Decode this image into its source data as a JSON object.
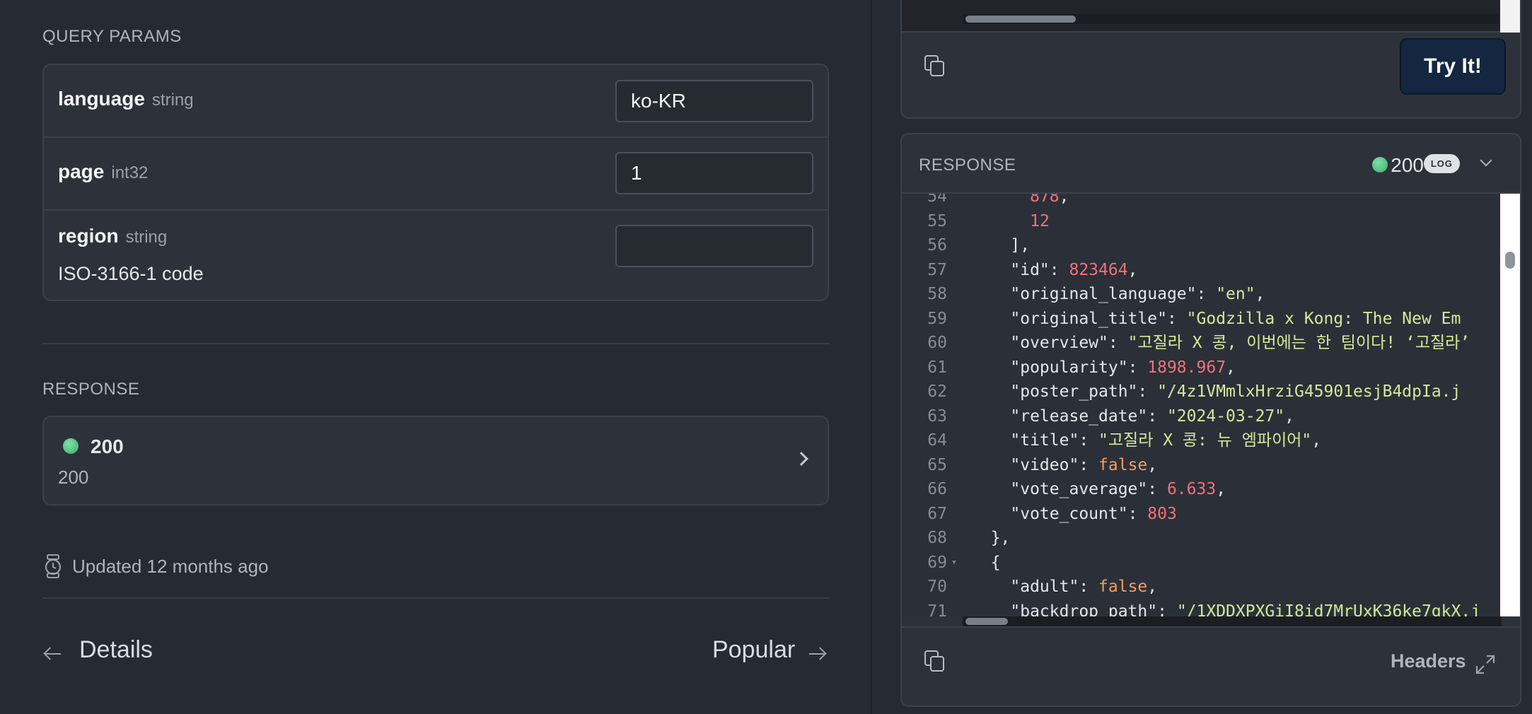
{
  "query_params": {
    "title": "QUERY PARAMS",
    "params": [
      {
        "name": "language",
        "type": "string",
        "value": "ko-KR",
        "description": ""
      },
      {
        "name": "page",
        "type": "int32",
        "value": "1",
        "description": ""
      },
      {
        "name": "region",
        "type": "string",
        "value": "",
        "description": "ISO-3166-1 code"
      }
    ]
  },
  "response_section": {
    "title": "RESPONSE",
    "status_code": "200",
    "status_description": "200"
  },
  "updated": "Updated 12 months ago",
  "nav": {
    "prev": "Details",
    "next": "Popular"
  },
  "request": {
    "try_button": "Try It!"
  },
  "response_panel": {
    "title": "RESPONSE",
    "status_code": "200",
    "log_badge": "LOG",
    "headers_label": "Headers",
    "code_lines": [
      {
        "n": "54",
        "parts": [
          {
            "t": "      ",
            "c": "p"
          },
          {
            "t": "878",
            "c": "n"
          },
          {
            "t": ",",
            "c": "p"
          }
        ]
      },
      {
        "n": "55",
        "parts": [
          {
            "t": "      ",
            "c": "p"
          },
          {
            "t": "12",
            "c": "n"
          }
        ]
      },
      {
        "n": "56",
        "parts": [
          {
            "t": "    ],",
            "c": "p"
          }
        ]
      },
      {
        "n": "57",
        "parts": [
          {
            "t": "    \"id\"",
            "c": "k"
          },
          {
            "t": ": ",
            "c": "p"
          },
          {
            "t": "823464",
            "c": "n"
          },
          {
            "t": ",",
            "c": "p"
          }
        ]
      },
      {
        "n": "58",
        "parts": [
          {
            "t": "    \"original_language\"",
            "c": "k"
          },
          {
            "t": ": ",
            "c": "p"
          },
          {
            "t": "\"en\"",
            "c": "s"
          },
          {
            "t": ",",
            "c": "p"
          }
        ]
      },
      {
        "n": "59",
        "parts": [
          {
            "t": "    \"original_title\"",
            "c": "k"
          },
          {
            "t": ": ",
            "c": "p"
          },
          {
            "t": "\"Godzilla x Kong: The New Em",
            "c": "s"
          }
        ]
      },
      {
        "n": "60",
        "parts": [
          {
            "t": "    \"overview\"",
            "c": "k"
          },
          {
            "t": ": ",
            "c": "p"
          },
          {
            "t": "\"고질라 X 콩, 이번에는 한 팀이다! ‘고질라’",
            "c": "s"
          }
        ]
      },
      {
        "n": "61",
        "parts": [
          {
            "t": "    \"popularity\"",
            "c": "k"
          },
          {
            "t": ": ",
            "c": "p"
          },
          {
            "t": "1898.967",
            "c": "n"
          },
          {
            "t": ",",
            "c": "p"
          }
        ]
      },
      {
        "n": "62",
        "parts": [
          {
            "t": "    \"poster_path\"",
            "c": "k"
          },
          {
            "t": ": ",
            "c": "p"
          },
          {
            "t": "\"/4z1VMmlxHrziG45901esjB4dpIa.j",
            "c": "s"
          }
        ]
      },
      {
        "n": "63",
        "parts": [
          {
            "t": "    \"release_date\"",
            "c": "k"
          },
          {
            "t": ": ",
            "c": "p"
          },
          {
            "t": "\"2024-03-27\"",
            "c": "s"
          },
          {
            "t": ",",
            "c": "p"
          }
        ]
      },
      {
        "n": "64",
        "parts": [
          {
            "t": "    \"title\"",
            "c": "k"
          },
          {
            "t": ": ",
            "c": "p"
          },
          {
            "t": "\"고질라 X 콩: 뉴 엠파이어\"",
            "c": "s"
          },
          {
            "t": ",",
            "c": "p"
          }
        ]
      },
      {
        "n": "65",
        "parts": [
          {
            "t": "    \"video\"",
            "c": "k"
          },
          {
            "t": ": ",
            "c": "p"
          },
          {
            "t": "false",
            "c": "b"
          },
          {
            "t": ",",
            "c": "p"
          }
        ]
      },
      {
        "n": "66",
        "parts": [
          {
            "t": "    \"vote_average\"",
            "c": "k"
          },
          {
            "t": ": ",
            "c": "p"
          },
          {
            "t": "6.633",
            "c": "n"
          },
          {
            "t": ",",
            "c": "p"
          }
        ]
      },
      {
        "n": "67",
        "parts": [
          {
            "t": "    \"vote_count\"",
            "c": "k"
          },
          {
            "t": ": ",
            "c": "p"
          },
          {
            "t": "803",
            "c": "n"
          }
        ]
      },
      {
        "n": "68",
        "parts": [
          {
            "t": "  },",
            "c": "p"
          }
        ]
      },
      {
        "n": "69",
        "fold": true,
        "parts": [
          {
            "t": "  {",
            "c": "p"
          }
        ]
      },
      {
        "n": "70",
        "parts": [
          {
            "t": "    \"adult\"",
            "c": "k"
          },
          {
            "t": ": ",
            "c": "p"
          },
          {
            "t": "false",
            "c": "b"
          },
          {
            "t": ",",
            "c": "p"
          }
        ]
      },
      {
        "n": "71",
        "parts": [
          {
            "t": "    \"backdrop_path\"",
            "c": "k"
          },
          {
            "t": ": ",
            "c": "p"
          },
          {
            "t": "\"/1XDDXPXGiI8id7MrUxK36ke7gkX.j",
            "c": "s"
          }
        ]
      }
    ]
  },
  "colors": {
    "success": "#4cc083",
    "try_button_bg": "#142640",
    "string": "#d4e89a",
    "number": "#f07178",
    "boolean": "#f59a62"
  }
}
